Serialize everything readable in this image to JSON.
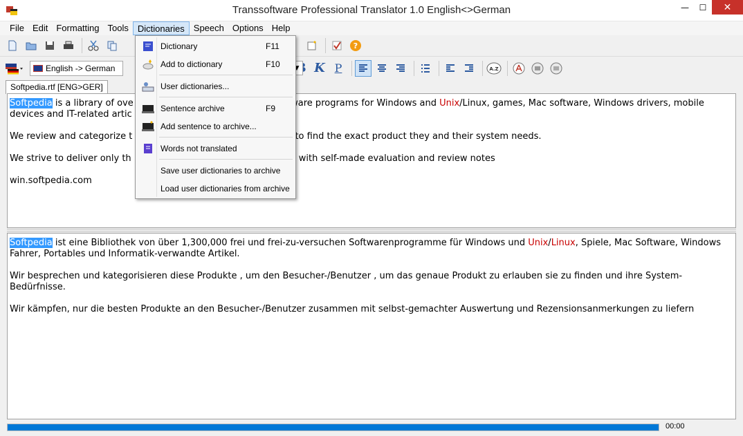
{
  "window": {
    "title": "Transsoftware Professional Translator 1.0 English<>German",
    "close_glyph": "✕",
    "min_glyph": "—",
    "max_glyph": "☐"
  },
  "menubar": [
    "File",
    "Edit",
    "Formatting",
    "Tools",
    "Dictionaries",
    "Speech",
    "Options",
    "Help"
  ],
  "toolbar2": {
    "language_pair": "English -> German",
    "bold": "B",
    "italic": "K",
    "underline": "P",
    "sort": "A.Z"
  },
  "tab": {
    "label": "Softpedia.rtf [ENG>GER]"
  },
  "dropdown": {
    "items": [
      {
        "label": "Dictionary",
        "shortcut": "F11",
        "icon": "dictionary-book-icon"
      },
      {
        "label": "Add to dictionary",
        "shortcut": "F10",
        "icon": "add-dictionary-icon"
      },
      {
        "label": "User dictionaries...",
        "shortcut": "",
        "icon": "user-dictionaries-icon"
      },
      {
        "label": "Sentence archive",
        "shortcut": "F9",
        "icon": "sentence-archive-icon"
      },
      {
        "label": "Add sentence to archive...",
        "shortcut": "",
        "icon": "add-sentence-icon"
      },
      {
        "label": "Words not translated",
        "shortcut": "",
        "icon": "words-not-translated-icon"
      },
      {
        "label": "Save user dictionaries to archive",
        "shortcut": "",
        "icon": ""
      },
      {
        "label": "Load user dictionaries from archive",
        "shortcut": "",
        "icon": ""
      }
    ]
  },
  "source": {
    "p1a": "Softpedia",
    "p1b": " is a library of ove",
    "p1c": "oftware programs for Windows and ",
    "p1d": "Unix",
    "p1e": "/Linux, games, Mac software, Windows drivers, mobile devices and IT-related artic",
    "p2a": "We review and categorize t",
    "p2b": "e visitor/user to find the exact product they and their system needs.",
    "p3a": "We strive to deliver only th",
    "p3b": "together with self-made evaluation and review notes",
    "p4": "win.softpedia.com"
  },
  "target": {
    "p1a": "Softpedia",
    "p1b": " ist eine Bibliothek von über 1,300,000 frei und frei-zu-versuchen Softwarenprogramme für Windows und ",
    "p1c": "Unix",
    "p1d": "/",
    "p1e": "Linux",
    "p1f": ", Spiele, Mac Software, Windows Fahrer, Portables und Informatik-verwandte Artikel.",
    "p2": "Wir besprechen und kategorisieren diese Produkte , um den Besucher-/Benutzer , um das genaue Produkt zu erlauben sie zu finden und ihre System-Bedürfnisse.",
    "p3": "Wir kämpfen,  nur die besten Produkte an den Besucher-/Benutzer zusammen mit selbst-gemachter Auswertung und Rezensionsanmerkungen zu liefern"
  },
  "status": {
    "timer": "00:00",
    "progress": 1.0
  }
}
